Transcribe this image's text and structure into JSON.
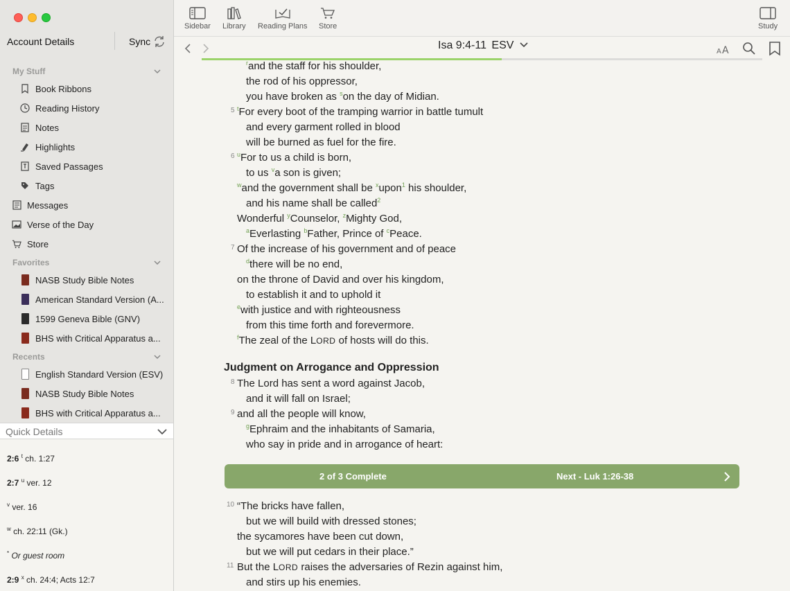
{
  "sidebar": {
    "account": "Account Details",
    "sync": "Sync",
    "my_stuff_header": "My Stuff",
    "my_stuff": [
      {
        "label": "Book Ribbons",
        "icon": "bookmark-icon"
      },
      {
        "label": "Reading History",
        "icon": "clock-icon"
      },
      {
        "label": "Notes",
        "icon": "note-icon"
      },
      {
        "label": "Highlights",
        "icon": "highlighter-icon"
      },
      {
        "label": "Saved Passages",
        "icon": "saved-passage-icon"
      },
      {
        "label": "Tags",
        "icon": "tag-icon"
      }
    ],
    "top_items": [
      {
        "label": "Messages",
        "icon": "messages-icon"
      },
      {
        "label": "Verse of the Day",
        "icon": "image-icon"
      },
      {
        "label": "Store",
        "icon": "cart-icon"
      }
    ],
    "favorites_header": "Favorites",
    "favorites": [
      {
        "label": "NASB Study Bible Notes",
        "color": "#7a2b1e"
      },
      {
        "label": "American Standard Version (A...",
        "color": "#3b2f5a"
      },
      {
        "label": "1599 Geneva Bible (GNV)",
        "color": "#2b2b2b"
      },
      {
        "label": "BHS with Critical Apparatus a...",
        "color": "#8a2a1c"
      }
    ],
    "recents_header": "Recents",
    "recents": [
      {
        "label": "English Standard Version (ESV)",
        "color": "#ffffff"
      },
      {
        "label": "NASB Study Bible Notes",
        "color": "#7a2b1e"
      },
      {
        "label": "BHS with Critical Apparatus a...",
        "color": "#8a2a1c"
      }
    ],
    "quick_details_title": "Quick Details",
    "quick_details": [
      {
        "ref": "2:6",
        "mark": "t",
        "text": "ch. 1:27",
        "italic": ""
      },
      {
        "ref": "2:7",
        "mark": "u",
        "text": "ver. 12",
        "italic": ""
      },
      {
        "ref": "",
        "mark": "v",
        "text": "ver. 16",
        "italic": ""
      },
      {
        "ref": "",
        "mark": "w",
        "text": "ch. 22:11 (Gk.)",
        "italic": ""
      },
      {
        "ref": "",
        "mark": "*",
        "text": "Or ",
        "italic": "guest room"
      },
      {
        "ref": "2:9",
        "mark": "x",
        "text": "ch. 24:4; Acts 12:7",
        "italic": ""
      }
    ]
  },
  "toolbar": {
    "sidebar": "Sidebar",
    "library": "Library",
    "reading_plans": "Reading Plans",
    "store": "Store",
    "study": "Study"
  },
  "nav": {
    "reference": "Isa 9:4-11",
    "version": "ESV",
    "progress_fraction": 0.535
  },
  "passage": {
    "lines": [
      {
        "vn": "",
        "fn": "r",
        "text": "and the staff for his shoulder,",
        "indent": true
      },
      {
        "vn": "",
        "fn": "",
        "text": "the rod of his oppressor,",
        "indent": true
      },
      {
        "vn": "",
        "fn": "",
        "text": "you have broken as ",
        "fn2": "s",
        "text2": "on the day of Midian.",
        "indent": true
      },
      {
        "vn": "5",
        "fn": "t",
        "text": "For every boot of the tramping warrior in battle tumult",
        "indent": false
      },
      {
        "vn": "",
        "fn": "",
        "text": "and every garment rolled in blood",
        "indent": true
      },
      {
        "vn": "",
        "fn": "",
        "text": "will be burned as fuel for the fire.",
        "indent": true
      },
      {
        "vn": "6",
        "fn": "u",
        "text": "For to us a child is born,",
        "indent": false
      },
      {
        "vn": "",
        "fn": "",
        "text": "to us ",
        "fn2": "v",
        "text2": "a son is given;",
        "indent": true
      },
      {
        "vn": "",
        "fn": "w",
        "text": "and the government shall be ",
        "fn2": "x",
        "text2": "upon",
        "fn3": "1",
        "text3": " his shoulder,",
        "indent": false
      },
      {
        "vn": "",
        "fn": "",
        "text": "and his name shall be called",
        "fn2": "2",
        "text2": "",
        "indent": true
      },
      {
        "vn": "",
        "fn": "",
        "text": "Wonderful ",
        "fn2": "y",
        "text2": "Counselor, ",
        "fn3": "z",
        "text3": "Mighty God,",
        "indent": false
      },
      {
        "vn": "",
        "fn": "a",
        "text": "Everlasting ",
        "fn2": "b",
        "text2": "Father, Prince of ",
        "fn3": "c",
        "text3": "Peace.",
        "indent": true
      },
      {
        "vn": "7",
        "fn": "",
        "text": "Of the increase of his government and of peace",
        "indent": false
      },
      {
        "vn": "",
        "fn": "d",
        "text": "there will be no end,",
        "indent": true
      },
      {
        "vn": "",
        "fn": "",
        "text": "on the throne of David and over his kingdom,",
        "indent": false
      },
      {
        "vn": "",
        "fn": "",
        "text": "to establish it and to uphold it",
        "indent": true
      },
      {
        "vn": "",
        "fn": "e",
        "text": "with justice and with righteousness",
        "indent": false
      },
      {
        "vn": "",
        "fn": "",
        "text": "from this time forth and forevermore.",
        "indent": true
      },
      {
        "vn": "",
        "fn": "f",
        "text": "The zeal of the L",
        "sc": "ORD",
        "text2": " of hosts will do this.",
        "indent": false
      }
    ],
    "heading": "Judgment on Arrogance and Oppression",
    "lines_b": [
      {
        "vn": "8",
        "fn": "",
        "text": "The Lord has sent a word against Jacob,",
        "indent": false
      },
      {
        "vn": "",
        "fn": "",
        "text": "and it will fall on Israel;",
        "indent": true
      },
      {
        "vn": "9",
        "fn": "",
        "text": "and all the people will know,",
        "indent": false
      },
      {
        "vn": "",
        "fn": "g",
        "text": "Ephraim and the inhabitants of Samaria,",
        "indent": true
      },
      {
        "vn": "",
        "fn": "",
        "text": "who say in pride and in arrogance of heart:",
        "indent": true
      }
    ],
    "lines_c": [
      {
        "vn": "10",
        "fn": "",
        "text": "“The bricks have fallen,",
        "indent": false
      },
      {
        "vn": "",
        "fn": "",
        "text": "but we will build with dressed stones;",
        "indent": true
      },
      {
        "vn": "",
        "fn": "",
        "text": "the sycamores have been cut down,",
        "indent": false
      },
      {
        "vn": "",
        "fn": "",
        "text": "but we will put cedars in their place.”",
        "indent": true
      },
      {
        "vn": "11",
        "fn": "",
        "text": "But the L",
        "sc": "ORD",
        "text2": " raises the adversaries of Rezin against him,",
        "indent": false
      },
      {
        "vn": "",
        "fn": "",
        "text": "and stirs up his enemies.",
        "indent": true
      }
    ]
  },
  "plan_bar": {
    "status": "2 of 3 Complete",
    "next": "Next - Luk 1:26-38"
  }
}
